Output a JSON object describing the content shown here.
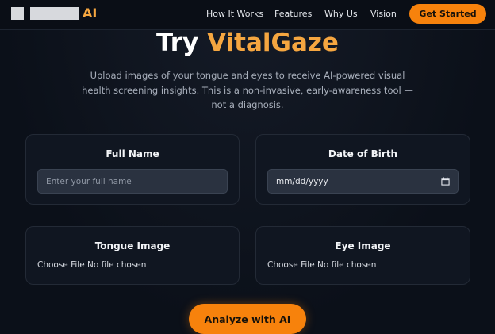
{
  "nav": {
    "logo_suffix": "AI",
    "links": [
      "How It Works",
      "Features",
      "Why Us",
      "Vision"
    ],
    "cta_label": "Get Started"
  },
  "hero": {
    "title_prefix": "Try",
    "title_brand": "VitalGaze",
    "subtitle": "Upload images of your tongue and eyes to receive AI-powered visual health screening insights. This is a non-invasive, early-awareness tool — not a diagnosis."
  },
  "form": {
    "full_name": {
      "label": "Full Name",
      "placeholder": "Enter your full name",
      "value": ""
    },
    "dob": {
      "label": "Date of Birth",
      "value": "mm/dd/yyyy"
    },
    "tongue": {
      "label": "Tongue Image",
      "file_button": "Choose File",
      "file_status": "No file chosen"
    },
    "eye": {
      "label": "Eye Image",
      "file_button": "Choose File",
      "file_status": "No file chosen"
    },
    "submit_label": "Analyze with AI"
  },
  "colors": {
    "accent": "#f7820c",
    "brand_text": "#f5a640",
    "background": "#0b1019",
    "card": "#101621"
  }
}
